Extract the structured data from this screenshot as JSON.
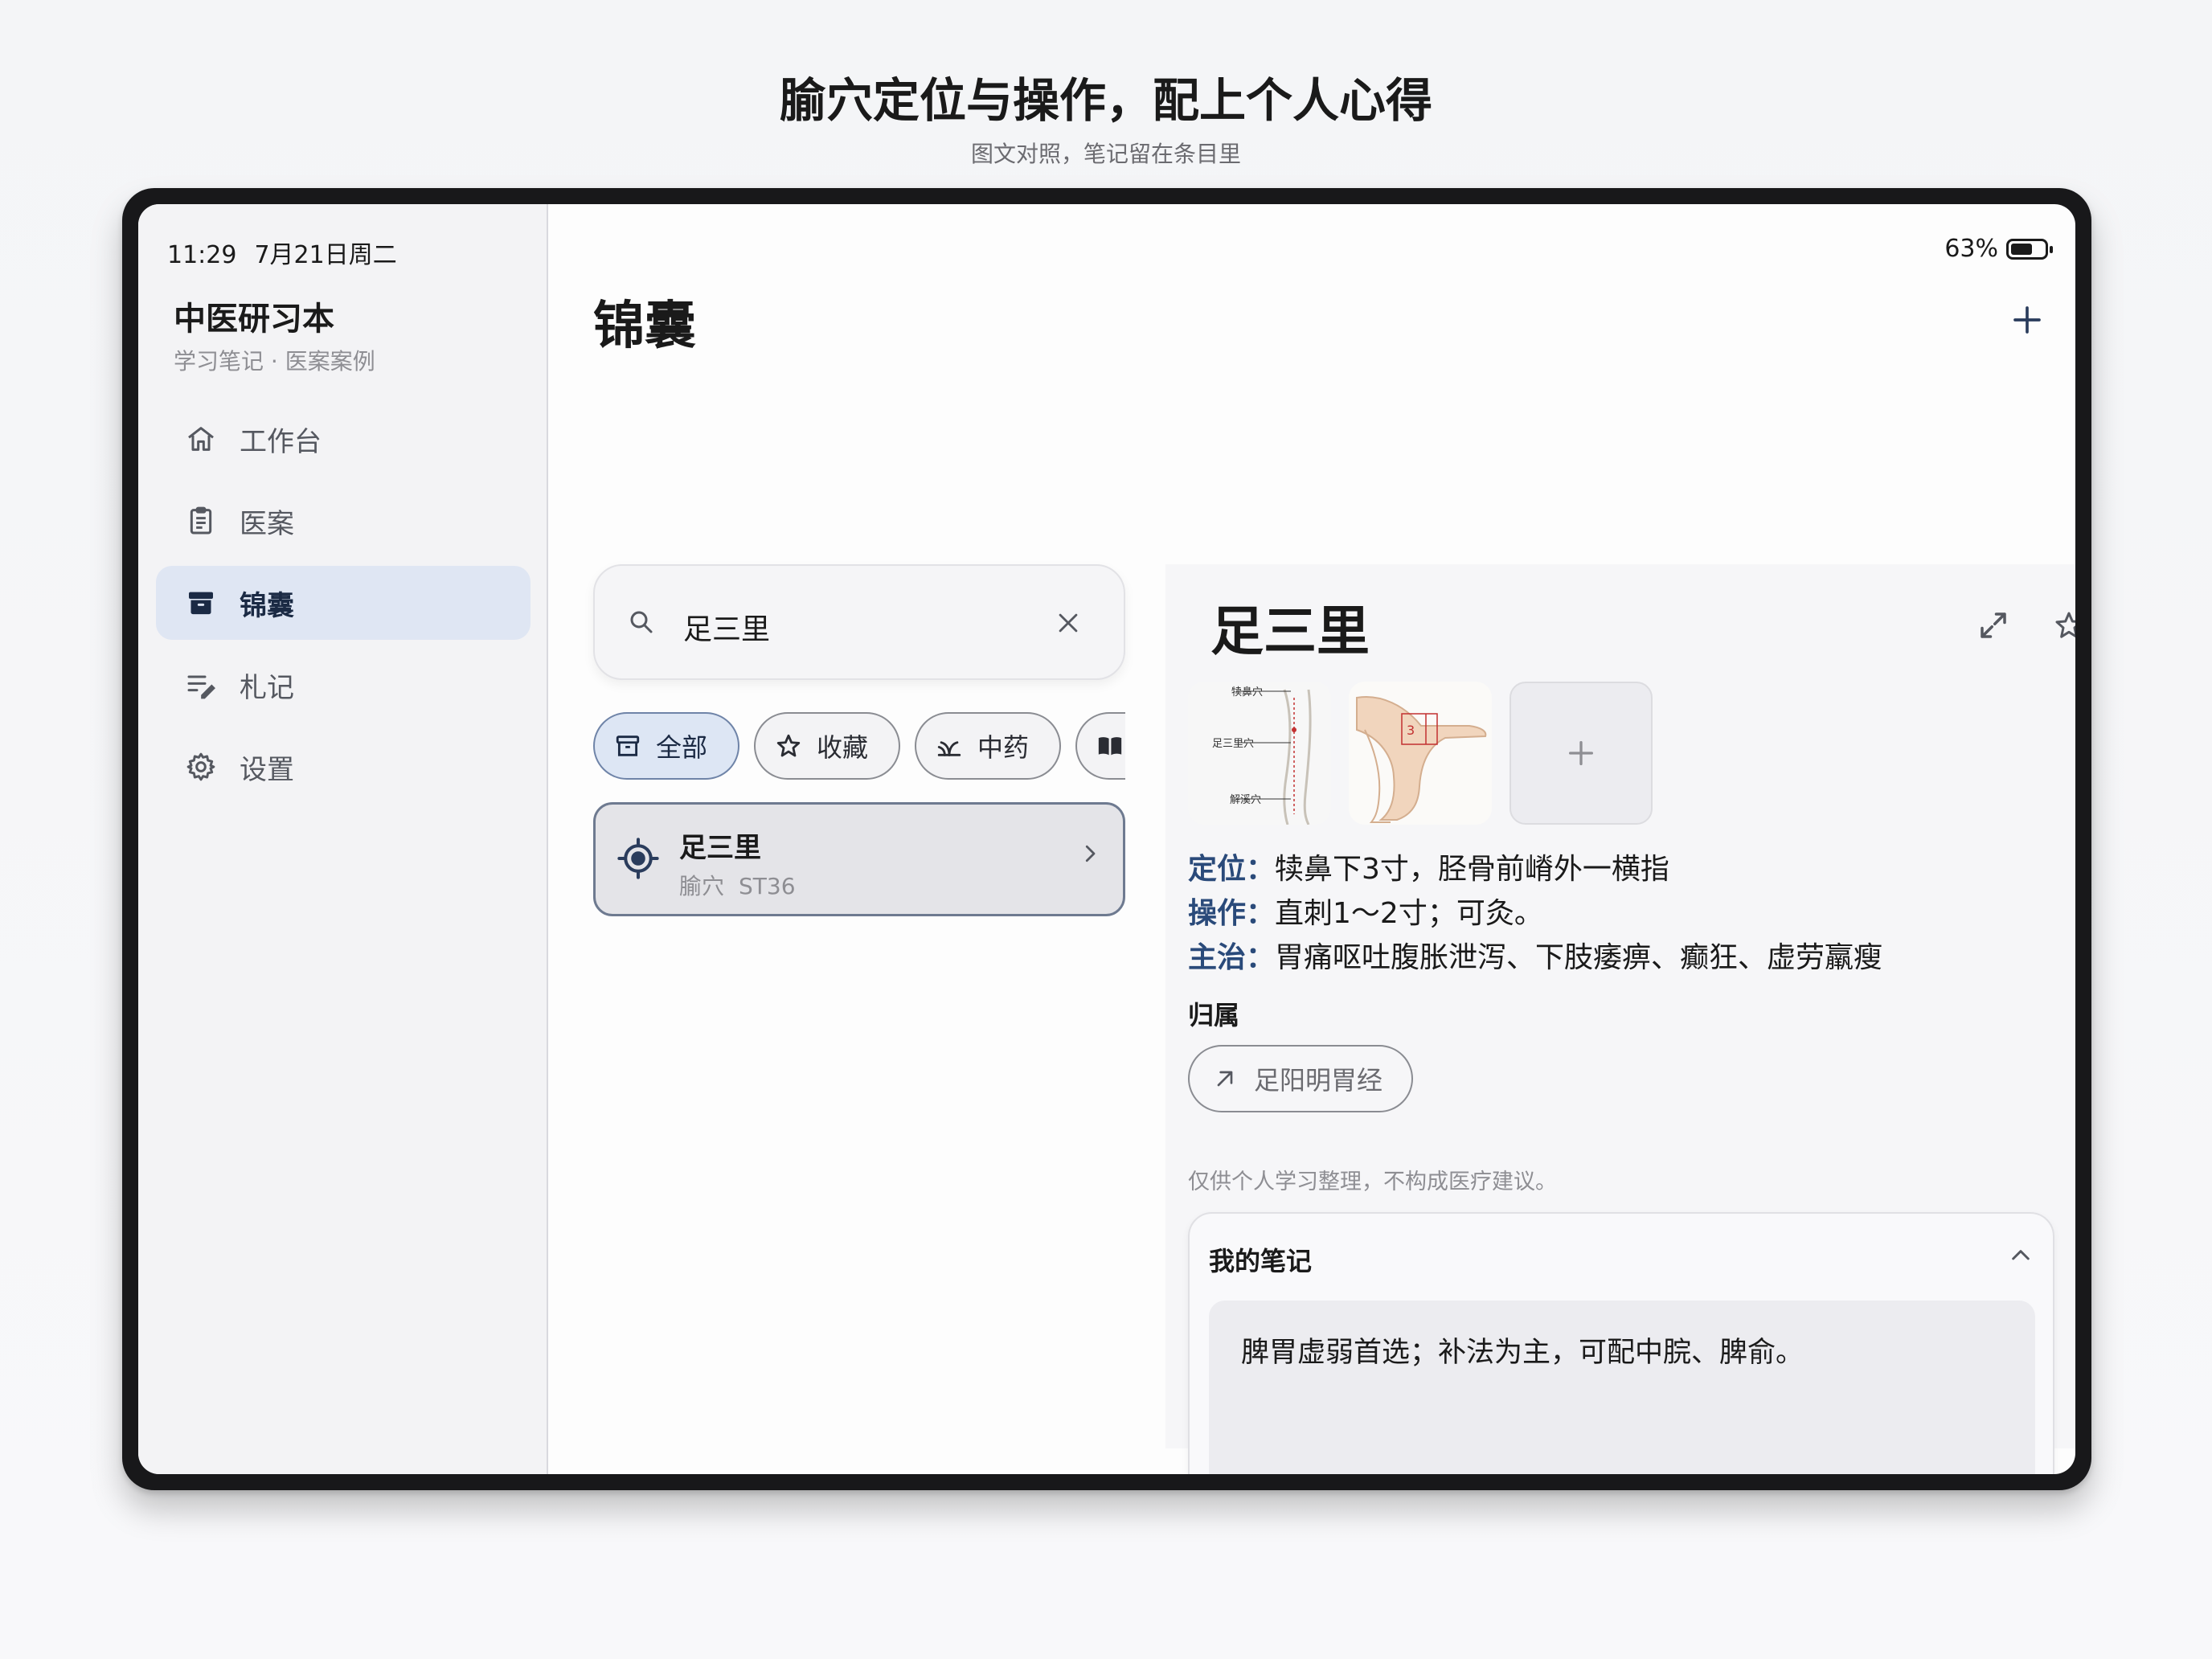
{
  "promo": {
    "title": "腧穴定位与操作，配上个人心得",
    "subtitle": "图文对照，笔记留在条目里"
  },
  "status_bar": {
    "time": "11:29",
    "date": "7月21日周二",
    "battery": "63%"
  },
  "sidebar": {
    "app_title": "中医研习本",
    "app_subtitle": "学习笔记 · 医案案例",
    "items": [
      {
        "label": "工作台",
        "icon": "home-icon"
      },
      {
        "label": "医案",
        "icon": "clipboard-icon"
      },
      {
        "label": "锦囊",
        "icon": "archive-box-icon",
        "active": true
      },
      {
        "label": "札记",
        "icon": "notes-edit-icon"
      },
      {
        "label": "设置",
        "icon": "gear-icon"
      }
    ]
  },
  "main": {
    "title": "锦囊",
    "search": {
      "value": "足三里"
    },
    "filters": [
      {
        "label": "全部",
        "icon": "archive-box-icon",
        "active": true
      },
      {
        "label": "收藏",
        "icon": "star-icon"
      },
      {
        "label": "中药",
        "icon": "herb-icon"
      },
      {
        "label": "",
        "icon": "book-icon"
      }
    ],
    "result": {
      "name": "足三里",
      "type": "腧穴",
      "code": "ST36"
    }
  },
  "detail": {
    "title": "足三里",
    "image_labels": {
      "img1_top": "犊鼻穴",
      "img1_mid": "足三里穴",
      "img1_bottom": "解溪穴"
    },
    "location_label": "定位：",
    "location": "犊鼻下3寸，胫骨前嵴外一横指",
    "operation_label": "操作：",
    "operation": "直刺1～2寸；可灸。",
    "indication_label": "主治：",
    "indication": "胃痛呕吐腹胀泄泻、下肢痿痹、癫狂、虚劳羸瘦",
    "belong_label": "归属",
    "meridian": "足阳明胃经",
    "disclaimer": "仅供个人学习整理，不构成医疗建议。",
    "notes": {
      "title": "我的笔记",
      "text": "脾胃虚弱首选；补法为主，可配中脘、脾俞。"
    }
  },
  "colors": {
    "accent": "#2a4a7a",
    "active_bg": "#dfe6f3"
  }
}
